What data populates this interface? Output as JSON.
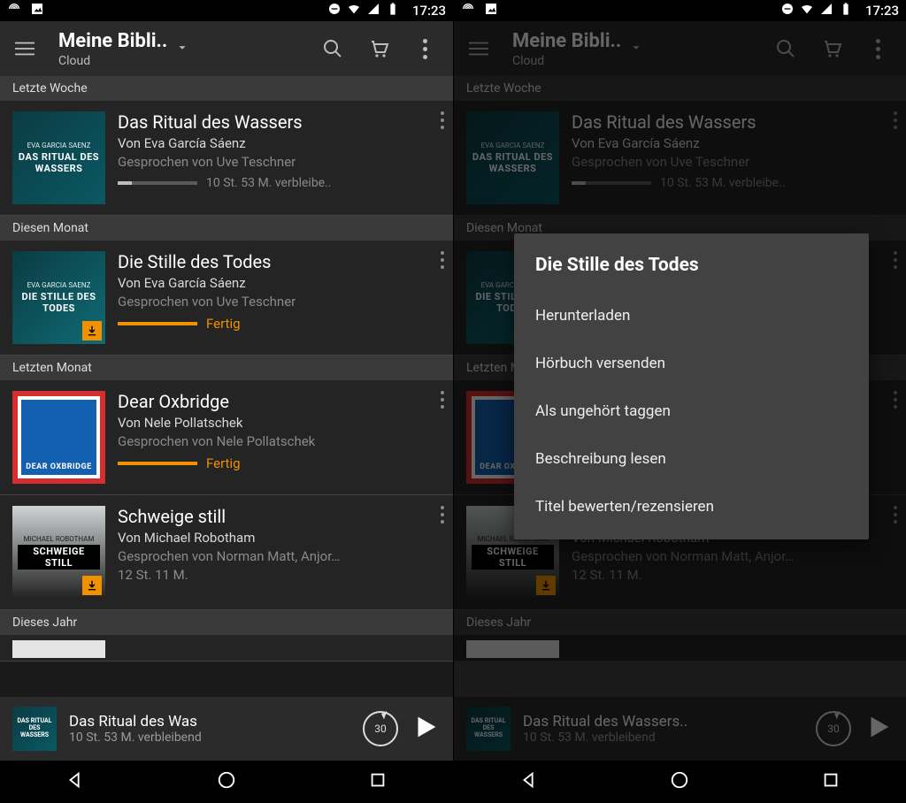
{
  "status": {
    "time": "17:23"
  },
  "appbar": {
    "title": "Meine Bibli..",
    "subtitle": "Cloud"
  },
  "sections": [
    {
      "header": "Letzte Woche"
    },
    {
      "header": "Diesen Monat"
    },
    {
      "header": "Letzten Monat"
    },
    {
      "header": "Dieses Jahr"
    }
  ],
  "items": [
    {
      "title": "Das Ritual des Wassers",
      "author": "Von Eva García Sáenz",
      "narrator": "Gesprochen von Uve Teschner",
      "remaining": "10 St. 53 M. verbleibe..",
      "coverAuthor": "EVA GARCIA SAENZ",
      "coverTitle": "DAS RITUAL DES WASSERS"
    },
    {
      "title": "Die Stille des Todes",
      "author": "Von Eva García Sáenz",
      "narrator": "Gesprochen von Uve Teschner",
      "status": "Fertig",
      "coverAuthor": "EVA GARCIA SAENZ",
      "coverTitle": "DIE STILLE DES TODES"
    },
    {
      "title": "Dear Oxbridge",
      "author": "Von Nele Pollatschek",
      "narrator": "Gesprochen von Nele Pollatschek",
      "status": "Fertig",
      "coverTitle": "DEAR OXBRIDGE"
    },
    {
      "title": "Schweige still",
      "author": "Von Michael Robotham",
      "narrator": "Gesprochen von Norman Matt, Anjor…",
      "duration": "12 St. 11 M.",
      "coverAuthor": "MICHAEL ROBOTHAM",
      "coverTitle": "SCHWEIGE STILL"
    }
  ],
  "miniplayer": {
    "titleA": "Das Ritual des Was",
    "titleB": "Das Ritual des Wassers..",
    "remaining": "10 St. 53 M. verbleibend",
    "cover": "DAS RITUAL DES WASSERS",
    "rewind": "30"
  },
  "popup": {
    "title": "Die Stille des Todes",
    "options": [
      "Herunterladen",
      "Hörbuch versenden",
      "Als ungehört taggen",
      "Beschreibung lesen",
      "Titel bewerten/rezensieren"
    ]
  }
}
